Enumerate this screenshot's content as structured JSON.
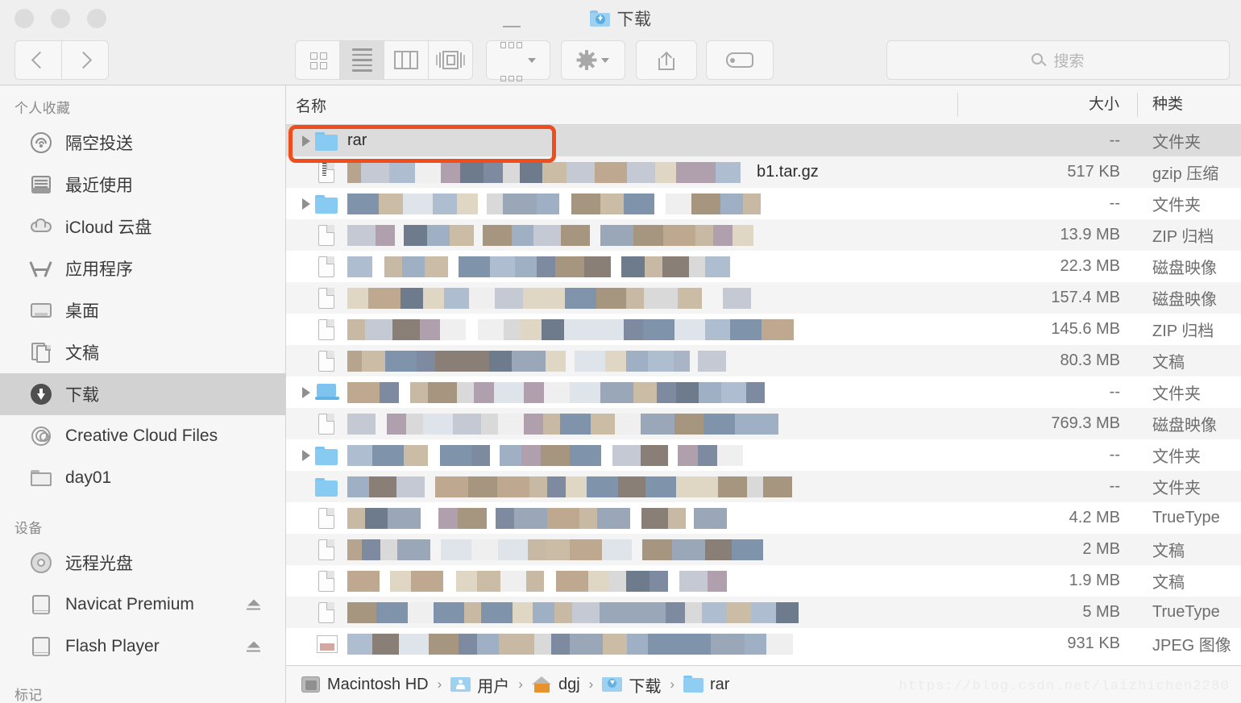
{
  "window": {
    "title": "下载",
    "title_icon": "download-folder-icon",
    "traffic_lights": [
      "close",
      "minimize",
      "zoom"
    ]
  },
  "toolbar": {
    "back_label": "后退",
    "forward_label": "前进",
    "views": [
      {
        "name": "icon-view",
        "label": "图标显示",
        "active": false
      },
      {
        "name": "list-view",
        "label": "列表显示",
        "active": true
      },
      {
        "name": "column-view",
        "label": "分栏显示",
        "active": false
      },
      {
        "name": "gallery-view",
        "label": "画廊显示",
        "active": false
      }
    ],
    "arrange_label": "排序方式",
    "action_label": "操作",
    "share_label": "共享",
    "tag_label": "标记"
  },
  "search": {
    "placeholder": "搜索",
    "value": ""
  },
  "sidebar": {
    "sections": [
      {
        "header": "个人收藏",
        "items": [
          {
            "label": "隔空投送",
            "icon": "airdrop-icon",
            "selected": false,
            "eject": false
          },
          {
            "label": "最近使用",
            "icon": "recents-icon",
            "selected": false,
            "eject": false
          },
          {
            "label": "iCloud 云盘",
            "icon": "icloud-icon",
            "selected": false,
            "eject": false
          },
          {
            "label": "应用程序",
            "icon": "applications-icon",
            "selected": false,
            "eject": false
          },
          {
            "label": "桌面",
            "icon": "desktop-icon",
            "selected": false,
            "eject": false
          },
          {
            "label": "文稿",
            "icon": "documents-icon",
            "selected": false,
            "eject": false
          },
          {
            "label": "下载",
            "icon": "downloads-icon",
            "selected": true,
            "eject": false
          },
          {
            "label": "Creative Cloud Files",
            "icon": "creative-cloud-icon",
            "selected": false,
            "eject": false
          },
          {
            "label": "day01",
            "icon": "folder-icon",
            "selected": false,
            "eject": false
          }
        ]
      },
      {
        "header": "设备",
        "items": [
          {
            "label": "远程光盘",
            "icon": "remote-disc-icon",
            "selected": false,
            "eject": false
          },
          {
            "label": "Navicat Premium",
            "icon": "drive-icon",
            "selected": false,
            "eject": true
          },
          {
            "label": "Flash Player",
            "icon": "drive-icon",
            "selected": false,
            "eject": true
          }
        ]
      },
      {
        "header": "标记",
        "items": []
      }
    ]
  },
  "file_list": {
    "columns": {
      "name": "名称",
      "size": "大小",
      "kind": "种类"
    },
    "rows": [
      {
        "name": "rar",
        "redacted": false,
        "icon": "folder-icon",
        "disclosure": true,
        "size": "--",
        "kind": "文件夹",
        "selected": true,
        "annotated": true
      },
      {
        "name": "b1.tar.gz",
        "redacted": true,
        "icon": "archive-file-icon",
        "disclosure": false,
        "size": "517 KB",
        "kind": "gzip 压缩",
        "selected": false,
        "annotated": false
      },
      {
        "name": "",
        "redacted": true,
        "icon": "folder-icon",
        "disclosure": true,
        "size": "--",
        "kind": "文件夹",
        "selected": false,
        "annotated": false
      },
      {
        "name": "",
        "redacted": true,
        "icon": "file-icon",
        "disclosure": false,
        "size": "13.9 MB",
        "kind": "ZIP 归档",
        "selected": false,
        "annotated": false
      },
      {
        "name": "",
        "redacted": true,
        "icon": "file-icon",
        "disclosure": false,
        "size": "22.3 MB",
        "kind": "磁盘映像",
        "selected": false,
        "annotated": false
      },
      {
        "name": "",
        "redacted": true,
        "icon": "file-icon",
        "disclosure": false,
        "size": "157.4 MB",
        "kind": "磁盘映像",
        "selected": false,
        "annotated": false
      },
      {
        "name": "",
        "redacted": true,
        "icon": "file-icon",
        "disclosure": false,
        "size": "145.6 MB",
        "kind": "ZIP 归档",
        "selected": false,
        "annotated": false
      },
      {
        "name": "",
        "redacted": true,
        "icon": "file-icon",
        "disclosure": false,
        "size": "80.3 MB",
        "kind": "文稿",
        "selected": false,
        "annotated": false
      },
      {
        "name": "",
        "redacted": true,
        "icon": "laptop-icon",
        "disclosure": true,
        "size": "--",
        "kind": "文件夹",
        "selected": false,
        "annotated": false
      },
      {
        "name": "",
        "redacted": true,
        "icon": "file-icon",
        "disclosure": false,
        "size": "769.3 MB",
        "kind": "磁盘映像",
        "selected": false,
        "annotated": false
      },
      {
        "name": "",
        "redacted": true,
        "icon": "folder-icon",
        "disclosure": true,
        "size": "--",
        "kind": "文件夹",
        "selected": false,
        "annotated": false
      },
      {
        "name": "",
        "redacted": true,
        "icon": "folder-icon",
        "disclosure": false,
        "size": "--",
        "kind": "文件夹",
        "selected": false,
        "annotated": false
      },
      {
        "name": "",
        "redacted": true,
        "icon": "file-icon",
        "disclosure": false,
        "size": "4.2 MB",
        "kind": "TrueType",
        "selected": false,
        "annotated": false
      },
      {
        "name": "",
        "redacted": true,
        "icon": "file-icon",
        "disclosure": false,
        "size": "2 MB",
        "kind": "文稿",
        "selected": false,
        "annotated": false
      },
      {
        "name": "",
        "redacted": true,
        "icon": "file-icon",
        "disclosure": false,
        "size": "1.9 MB",
        "kind": "文稿",
        "selected": false,
        "annotated": false
      },
      {
        "name": "",
        "redacted": true,
        "icon": "file-icon",
        "disclosure": false,
        "size": "5 MB",
        "kind": "TrueType",
        "selected": false,
        "annotated": false
      },
      {
        "name": "",
        "redacted": true,
        "icon": "image-icon",
        "disclosure": false,
        "size": "931 KB",
        "kind": "JPEG 图像",
        "selected": false,
        "annotated": false
      }
    ]
  },
  "path_bar": {
    "crumbs": [
      {
        "label": "Macintosh HD",
        "icon": "hard-disk-icon"
      },
      {
        "label": "用户",
        "icon": "users-folder-icon"
      },
      {
        "label": "dgj",
        "icon": "home-icon"
      },
      {
        "label": "下载",
        "icon": "download-folder-icon"
      },
      {
        "label": "rar",
        "icon": "folder-icon"
      }
    ],
    "separator": "›"
  },
  "annotation": {
    "color": "#ee4d1e",
    "target_row": "rar"
  },
  "watermark": "https://blog.csdn.net/laizhichen2280"
}
